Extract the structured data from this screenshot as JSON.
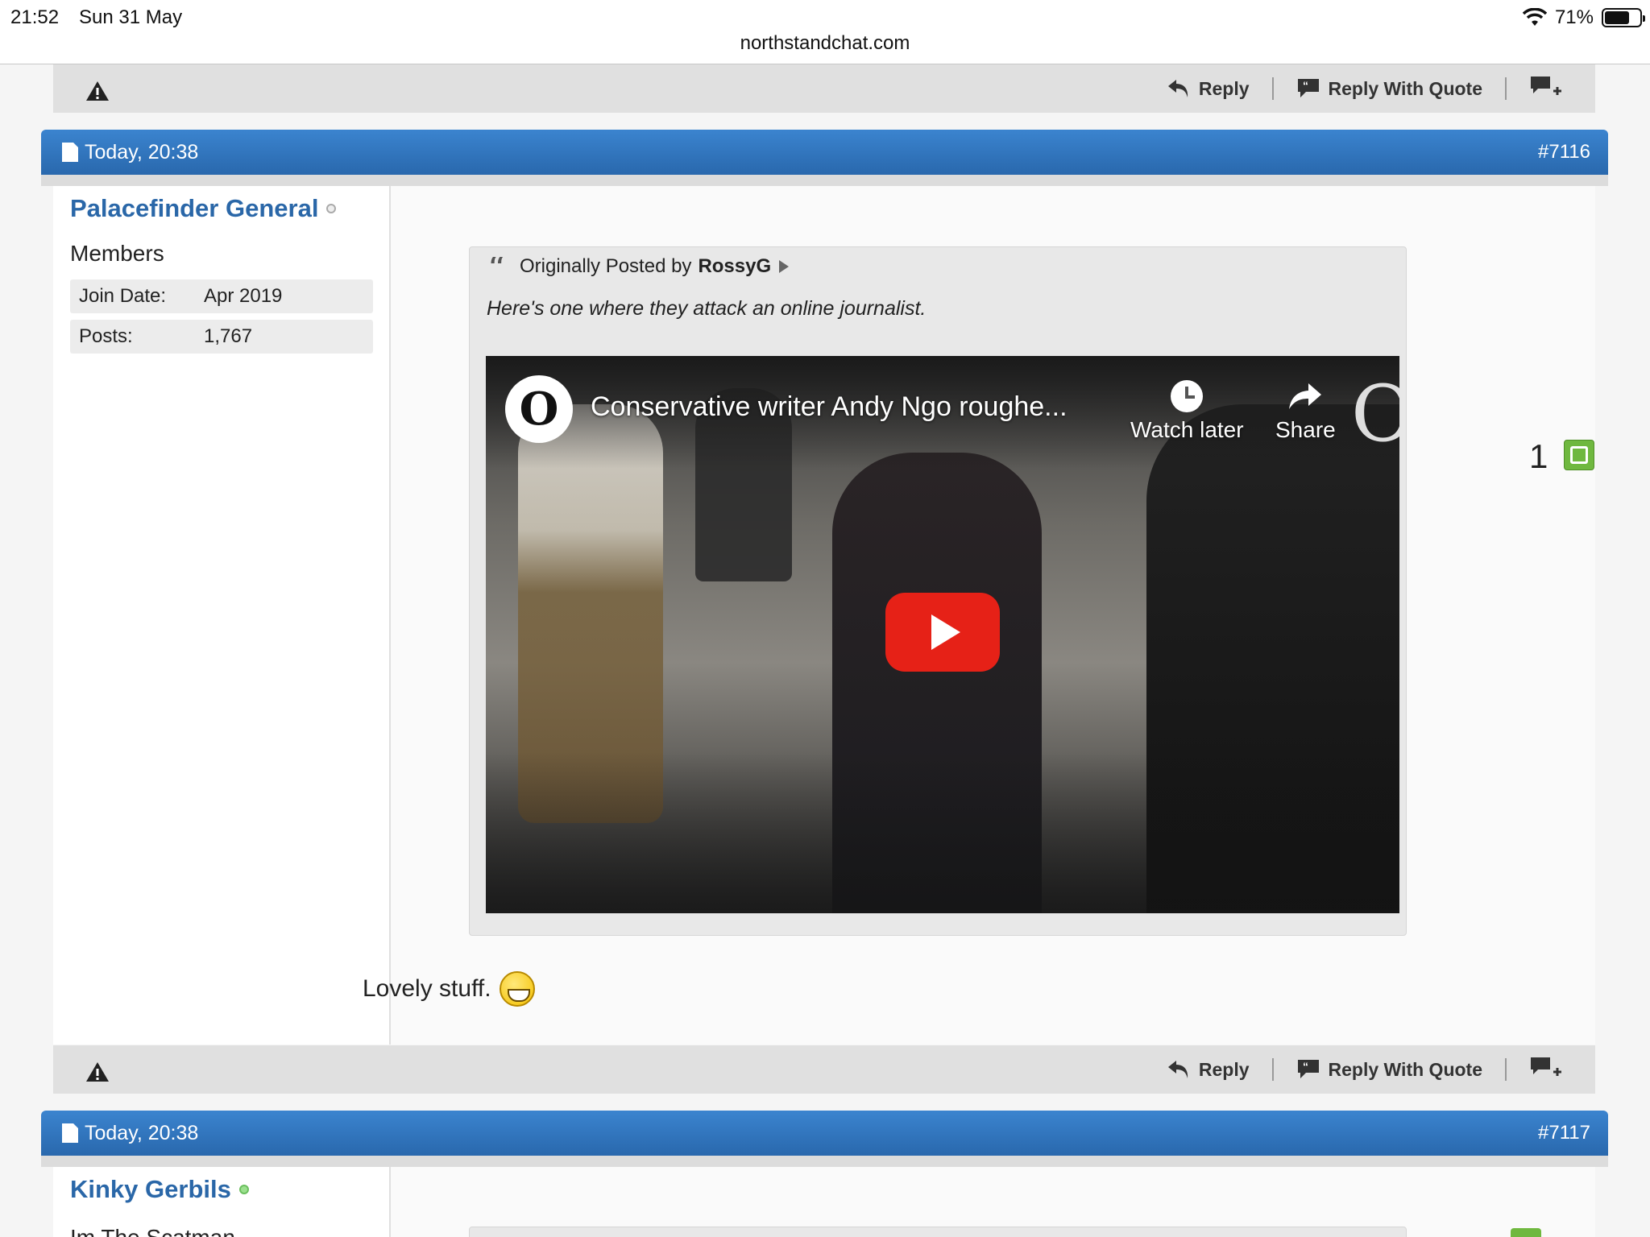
{
  "status_bar": {
    "time": "21:52",
    "date": "Sun 31 May",
    "battery": "71%",
    "battery_level": 0.71
  },
  "browser": {
    "url": "northstandchat.com"
  },
  "actions": {
    "reply": "Reply",
    "reply_with_quote": "Reply With Quote"
  },
  "posts": [
    {
      "date": "Today, 20:38",
      "number": "#7116",
      "username": "Palacefinder General",
      "online": false,
      "user_title": "Members",
      "join_date_label": "Join Date:",
      "join_date": "Apr 2019",
      "posts_label": "Posts:",
      "posts_count": "1,767",
      "quote": {
        "prefix": "Originally Posted by",
        "author": "RossyG",
        "text": "Here's one where they attack an online journalist."
      },
      "video": {
        "title": "Conservative writer Andy Ngo roughe...",
        "watch_later": "Watch later",
        "share": "Share"
      },
      "message": "Lovely stuff.",
      "likes": "1"
    },
    {
      "date": "Today, 20:38",
      "number": "#7117",
      "username": "Kinky Gerbils",
      "online": true,
      "user_title": "Im The Scatman"
    }
  ],
  "colors": {
    "header_blue": "#2f72ba",
    "username_blue": "#2a67a8",
    "like_green": "#6fb83f",
    "play_red": "#e62117"
  }
}
